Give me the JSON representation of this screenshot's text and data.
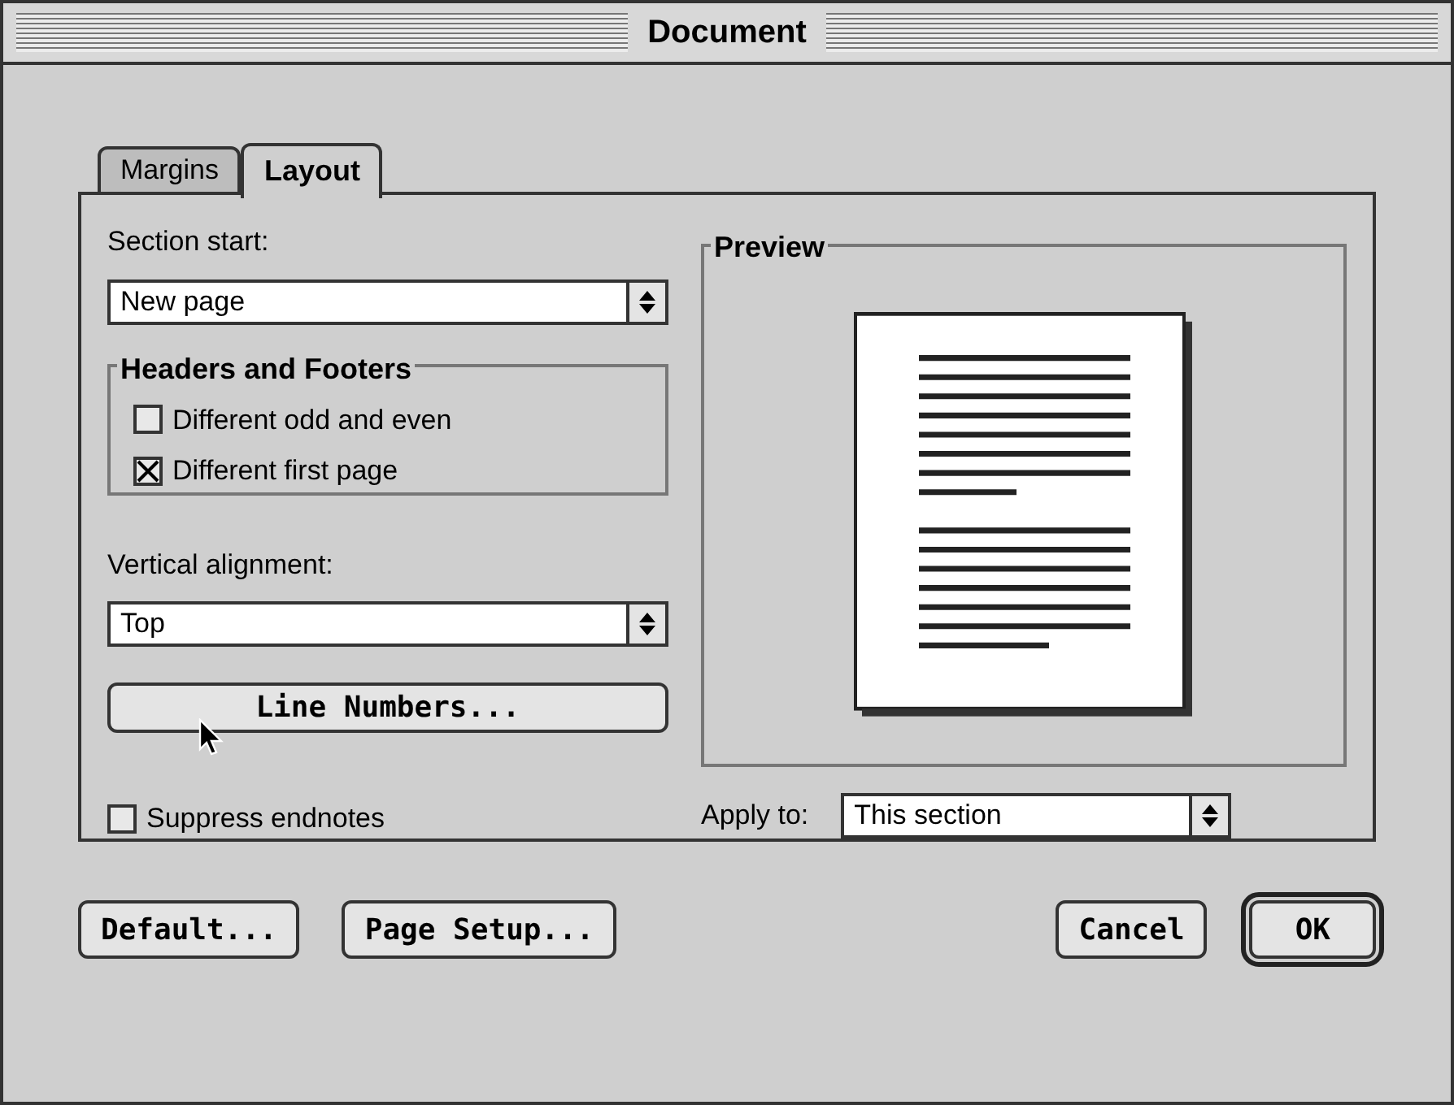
{
  "window": {
    "title": "Document"
  },
  "tabs": [
    {
      "label": "Margins",
      "selected": false
    },
    {
      "label": "Layout",
      "selected": true
    }
  ],
  "section_start": {
    "label": "Section start:",
    "value": "New page"
  },
  "headers_footers": {
    "title": "Headers and Footers",
    "options": [
      {
        "label": "Different odd and even",
        "checked": false
      },
      {
        "label": "Different first page",
        "checked": true
      }
    ]
  },
  "vertical_alignment": {
    "label": "Vertical alignment:",
    "value": "Top"
  },
  "line_numbers_button": {
    "label": "Line Numbers..."
  },
  "suppress_endnotes": {
    "label": "Suppress endnotes",
    "checked": false
  },
  "preview": {
    "title": "Preview"
  },
  "apply_to": {
    "label": "Apply to:",
    "value": "This section"
  },
  "left_buttons": [
    {
      "label": "Default...",
      "default": false
    },
    {
      "label": "Page Setup...",
      "default": false
    }
  ],
  "right_buttons": [
    {
      "label": "Cancel",
      "default": false
    },
    {
      "label": "OK",
      "default": true
    }
  ]
}
